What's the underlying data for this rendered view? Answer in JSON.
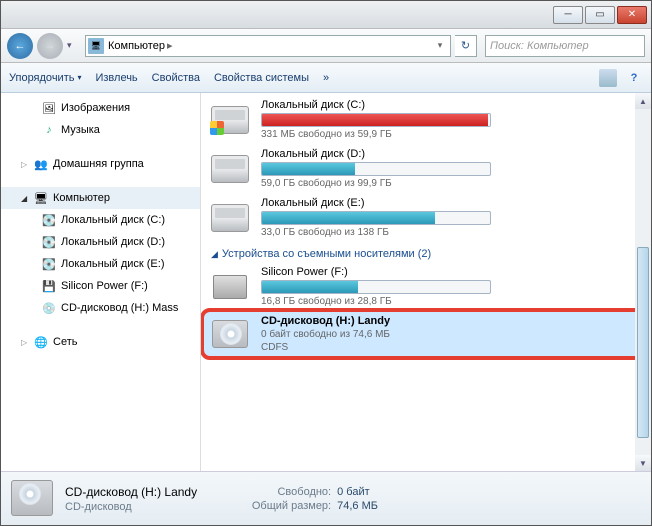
{
  "titlebar": {},
  "navbar": {
    "location": "Компьютер",
    "search_placeholder": "Поиск: Компьютер"
  },
  "toolbar": {
    "organize": "Упорядочить",
    "extract": "Извлечь",
    "properties": "Свойства",
    "sys_properties": "Свойства системы",
    "chevron": "»"
  },
  "sidebar": {
    "images": "Изображения",
    "music": "Музыка",
    "homegroup": "Домашняя группа",
    "computer": "Компьютер",
    "disk_c": "Локальный диск (C:)",
    "disk_d": "Локальный диск (D:)",
    "disk_e": "Локальный диск (E:)",
    "silicon": "Silicon Power (F:)",
    "cd": "CD-дисковод (H:) Mass",
    "network": "Сеть"
  },
  "group": {
    "removable": "Устройства со съемными носителями (2)"
  },
  "drives": {
    "c": {
      "name": "Локальный диск (C:)",
      "status": "331 МБ свободно из 59,9 ГБ",
      "fill": 99,
      "critical": true
    },
    "d": {
      "name": "Локальный диск (D:)",
      "status": "59,0 ГБ свободно из 99,9 ГБ",
      "fill": 41
    },
    "e": {
      "name": "Локальный диск (E:)",
      "status": "33,0 ГБ свободно из 138 ГБ",
      "fill": 76
    },
    "f": {
      "name": "Silicon Power (F:)",
      "status": "16,8 ГБ свободно из 28,8 ГБ",
      "fill": 42
    },
    "h": {
      "name": "CD-дисковод (H:) Landy",
      "status": "0 байт свободно из 74,6 МБ",
      "fs": "CDFS"
    }
  },
  "statusbar": {
    "title": "CD-дисковод (H:) Landy",
    "subtitle": "CD-дисковод",
    "free_label": "Свободно:",
    "free_val": "0 байт",
    "size_label": "Общий размер:",
    "size_val": "74,6 МБ"
  }
}
